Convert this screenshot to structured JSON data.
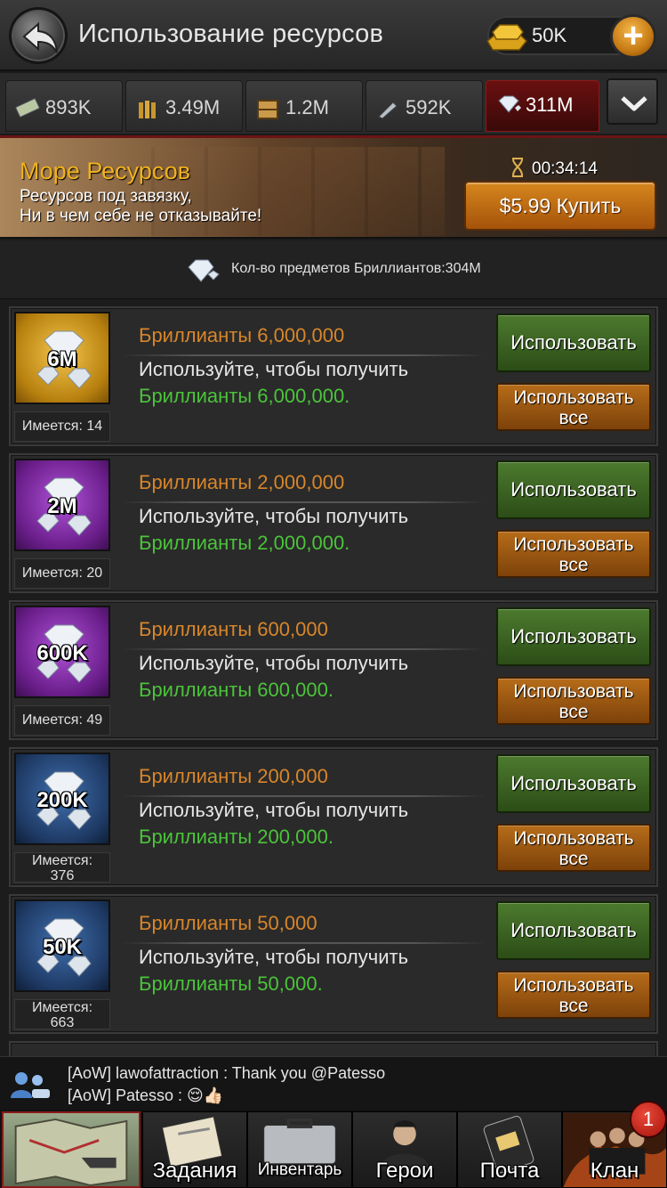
{
  "header": {
    "title": "Использование ресурсов",
    "gold": "50K"
  },
  "resource_tabs": [
    {
      "icon": "cash-icon",
      "value": "893K",
      "active": false
    },
    {
      "icon": "ammo-icon",
      "value": "3.49M",
      "active": false
    },
    {
      "icon": "crate-icon",
      "value": "1.2M",
      "active": false
    },
    {
      "icon": "metal-icon",
      "value": "592K",
      "active": false
    },
    {
      "icon": "diamond-icon",
      "value": "311M",
      "active": true
    }
  ],
  "banner": {
    "title": "Море Ресурсов",
    "line1": "Ресурсов под завязку,",
    "line2": "Ни в чем себе не отказывайте!",
    "timer": "00:34:14",
    "buy_label": "$5.99 Купить"
  },
  "count": {
    "label": "Кол-во предметов Бриллиантов:304M"
  },
  "items": [
    {
      "badge": "6M",
      "theme": "gold",
      "have_line1": "Имеется: 14",
      "have_line2": "",
      "title": "Бриллианты 6,000,000",
      "desc": "Используйте, чтобы получить",
      "reward": "Бриллианты 6,000,000."
    },
    {
      "badge": "2M",
      "theme": "purple",
      "have_line1": "Имеется: 20",
      "have_line2": "",
      "title": "Бриллианты 2,000,000",
      "desc": "Используйте, чтобы получить",
      "reward": "Бриллианты 2,000,000."
    },
    {
      "badge": "600K",
      "theme": "purple",
      "have_line1": "Имеется: 49",
      "have_line2": "",
      "title": "Бриллианты 600,000",
      "desc": "Используйте, чтобы получить",
      "reward": "Бриллианты 600,000."
    },
    {
      "badge": "200K",
      "theme": "blue",
      "have_line1": "Имеется:",
      "have_line2": "376",
      "title": "Бриллианты 200,000",
      "desc": "Используйте, чтобы получить",
      "reward": "Бриллианты 200,000."
    },
    {
      "badge": "50K",
      "theme": "blue",
      "have_line1": "Имеется:",
      "have_line2": "663",
      "title": "Бриллианты 50,000",
      "desc": "Используйте, чтобы получить",
      "reward": "Бриллианты 50,000."
    }
  ],
  "buttons": {
    "use": "Использовать",
    "use_all_line1": "Использовать",
    "use_all_line2": "все"
  },
  "chat": {
    "line1": "[AoW] lawofattraction : Thank you @Patesso",
    "line2": "[AoW] Patesso : 😌👍🏻"
  },
  "bottom_nav": {
    "tasks": "Задания",
    "inventory": "Инвентарь",
    "heroes": "Герои",
    "mail": "Почта",
    "clan": "Клан",
    "clan_badge": "1"
  },
  "colors": {
    "item_title": "#d8862a",
    "reward": "#4bc43a",
    "banner_title": "#f1b21c",
    "use_button": "#3c6324",
    "use_all_button": "#9a5712"
  }
}
